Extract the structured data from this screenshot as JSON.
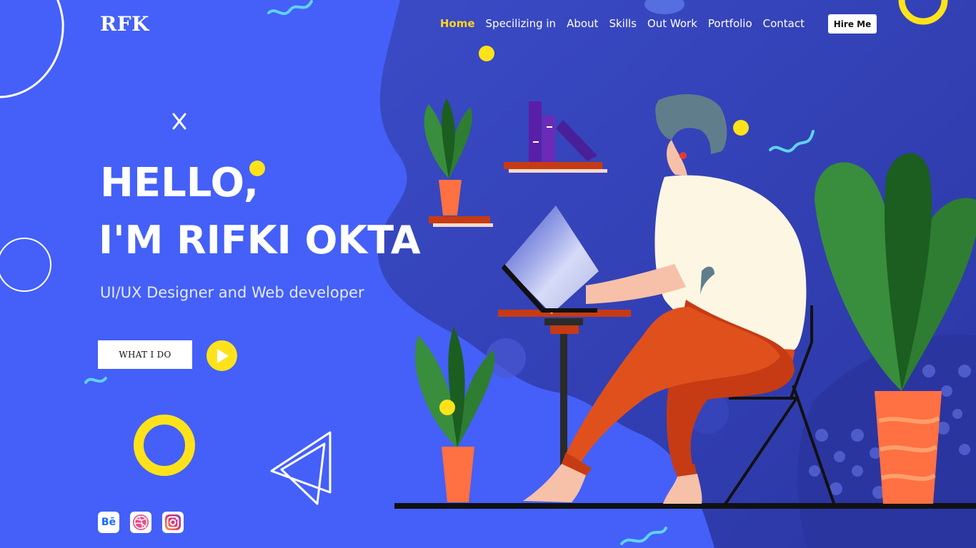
{
  "brand": {
    "logo_text": "RFK"
  },
  "nav": {
    "items": [
      {
        "label": "Home",
        "active": true
      },
      {
        "label": "Specilizing in",
        "active": false
      },
      {
        "label": "About",
        "active": false
      },
      {
        "label": "Skills",
        "active": false
      },
      {
        "label": "Out Work",
        "active": false
      },
      {
        "label": "Portfolio",
        "active": false
      },
      {
        "label": "Contact",
        "active": false
      }
    ],
    "hire_label": "Hire Me"
  },
  "hero": {
    "greeting": "HELLO,",
    "name_line": "I'M RIFKI OKTA",
    "subtitle": "UI/UX Designer and Web developer",
    "cta_label": "WHAT I DO"
  },
  "social": {
    "behance_text": "Bē",
    "icons": [
      "behance-icon",
      "dribbble-icon",
      "instagram-icon"
    ]
  },
  "colors": {
    "background": "#4460f8",
    "blob": "#3140b0",
    "accent_yellow": "#ffe21a",
    "nav_active": "#ffd41c",
    "pants": "#d94a1c",
    "shirt": "#fdf6e3",
    "plant_green": "#2e7d32",
    "pot_orange": "#ff7043"
  }
}
